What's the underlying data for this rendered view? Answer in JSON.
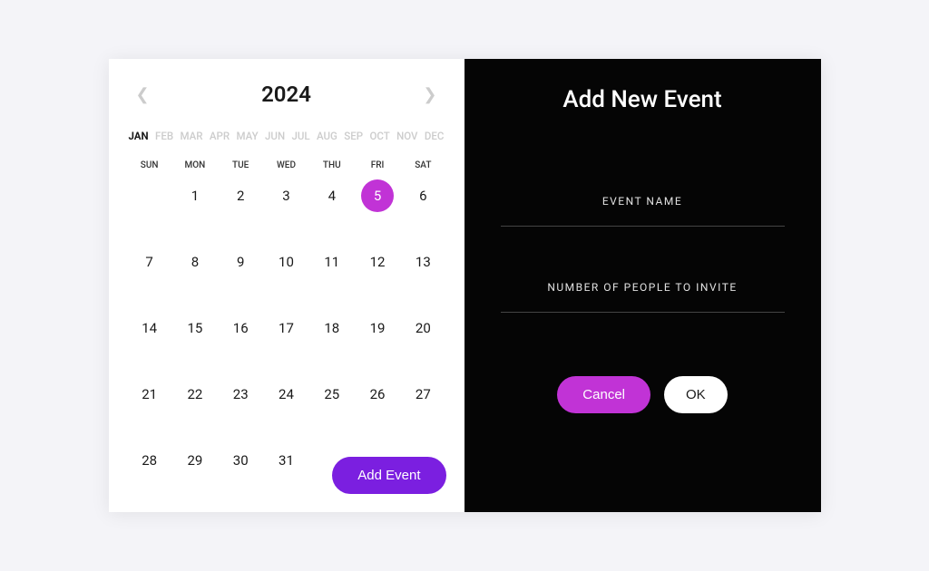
{
  "calendar": {
    "year": "2024",
    "months": [
      "JAN",
      "FEB",
      "MAR",
      "APR",
      "MAY",
      "JUN",
      "JUL",
      "AUG",
      "SEP",
      "OCT",
      "NOV",
      "DEC"
    ],
    "active_month_index": 0,
    "weekdays": [
      "SUN",
      "MON",
      "TUE",
      "WED",
      "THU",
      "FRI",
      "SAT"
    ],
    "selected_day": 5,
    "days": [
      "",
      "1",
      "2",
      "3",
      "4",
      "5",
      "6",
      "7",
      "8",
      "9",
      "10",
      "11",
      "12",
      "13",
      "14",
      "15",
      "16",
      "17",
      "18",
      "19",
      "20",
      "21",
      "22",
      "23",
      "24",
      "25",
      "26",
      "27",
      "28",
      "29",
      "30",
      "31"
    ]
  },
  "add_event_button": "Add Event",
  "event_panel": {
    "title": "Add New Event",
    "label_name": "EVENT NAME",
    "label_people": "NUMBER OF PEOPLE TO INVITE",
    "cancel": "Cancel",
    "ok": "OK"
  }
}
